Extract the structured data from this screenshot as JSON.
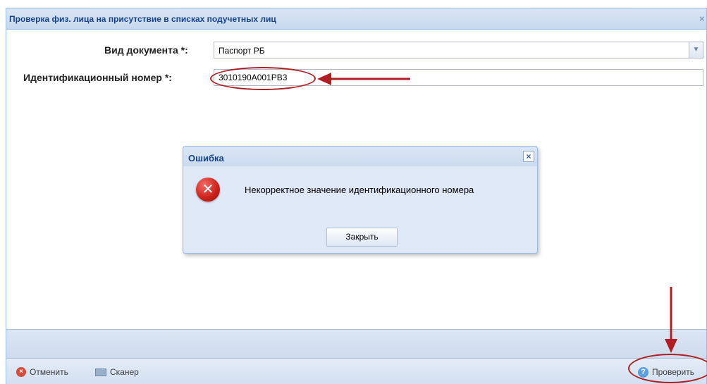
{
  "window": {
    "title": "Проверка физ. лица на присутствие в списках подучетных лиц",
    "close_glyph": "×"
  },
  "form": {
    "doc_type_label": "Вид документа *:",
    "doc_type_value": "Паспорт РБ",
    "id_number_label": "Идентификационный номер *:",
    "id_number_value": "3010190A001PB3"
  },
  "dialog": {
    "title": "Ошибка",
    "close_glyph": "×",
    "icon": "error-icon",
    "message": "Некорректное значение идентификационного номера",
    "close_button_label": "Закрыть"
  },
  "toolbar": {
    "cancel_label": "Отменить",
    "scanner_label": "Сканер",
    "check_label": "Проверить"
  },
  "annotation_color": "#b01e23"
}
